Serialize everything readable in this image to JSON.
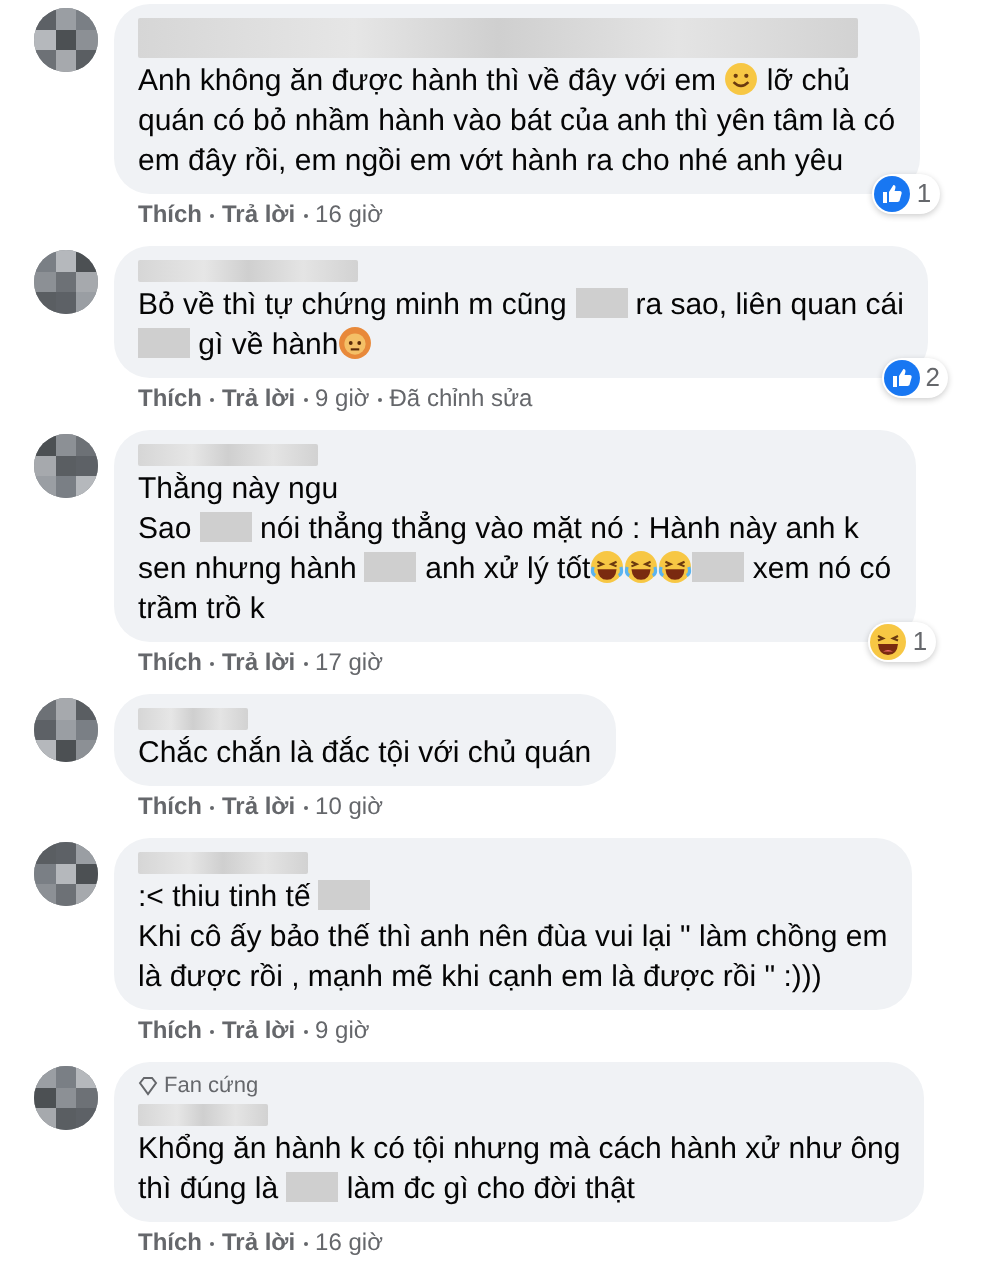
{
  "comments": [
    {
      "author_blurred": true,
      "lines": [
        [
          {
            "kind": "text",
            "text": "Anh không ăn được hành thì về đây với em "
          },
          {
            "kind": "smile"
          },
          {
            "kind": "text",
            "text": " lỡ chủ"
          }
        ],
        [
          {
            "kind": "text",
            "text": "quán có bỏ nhầm hành vào bát của anh thì yên tâm là có"
          }
        ],
        [
          {
            "kind": "text",
            "text": "em đây rồi, em ngồi em vớt hành ra cho nhé anh yêu"
          }
        ]
      ],
      "reaction": {
        "kind": "like",
        "count": "1"
      },
      "actions": [
        "Thích",
        "Trả lời",
        "16 giờ"
      ]
    },
    {
      "author_blurred": true,
      "lines": [
        [
          {
            "kind": "text",
            "text": "Bỏ về thì tự chứng minh m cũng "
          },
          {
            "kind": "censor"
          },
          {
            "kind": "text",
            "text": " ra sao, liên quan cái"
          }
        ],
        [
          {
            "kind": "censor"
          },
          {
            "kind": "text",
            "text": " gì về hành"
          },
          {
            "kind": "angry"
          }
        ]
      ],
      "reaction": {
        "kind": "like",
        "count": "2"
      },
      "actions": [
        "Thích",
        "Trả lời",
        "9 giờ",
        "Đã chỉnh sửa"
      ]
    },
    {
      "author_blurred": true,
      "lines": [
        [
          {
            "kind": "text",
            "text": "Thằng này ngu"
          }
        ],
        [
          {
            "kind": "text",
            "text": "Sao "
          },
          {
            "kind": "censor"
          },
          {
            "kind": "text",
            "text": " nói thẳng thẳng vào mặt nó : Hành này anh k"
          }
        ],
        [
          {
            "kind": "text",
            "text": "sen nhưng hành "
          },
          {
            "kind": "censor"
          },
          {
            "kind": "text",
            "text": " anh xử lý tốt"
          },
          {
            "kind": "laugh"
          },
          {
            "kind": "laugh"
          },
          {
            "kind": "laugh"
          },
          {
            "kind": "censor"
          },
          {
            "kind": "text",
            "text": " xem nó có"
          }
        ],
        [
          {
            "kind": "text",
            "text": "trầm trồ k"
          }
        ]
      ],
      "reaction": {
        "kind": "haha",
        "count": "1"
      },
      "actions": [
        "Thích",
        "Trả lời",
        "17 giờ"
      ]
    },
    {
      "author_blurred": true,
      "lines": [
        [
          {
            "kind": "text",
            "text": "Chắc chắn là đắc tội với chủ quán"
          }
        ]
      ],
      "actions": [
        "Thích",
        "Trả lời",
        "10 giờ"
      ]
    },
    {
      "author_blurred": true,
      "lines": [
        [
          {
            "kind": "text",
            "text": ":< thiu tinh tế "
          },
          {
            "kind": "censor"
          }
        ],
        [
          {
            "kind": "text",
            "text": "Khi cô ấy bảo thế thì anh nên đùa vui lại \" làm chồng em"
          }
        ],
        [
          {
            "kind": "text",
            "text": "là được rồi , mạnh mẽ khi cạnh em là được rồi \" :)))"
          }
        ]
      ],
      "actions": [
        "Thích",
        "Trả lời",
        "9 giờ"
      ]
    },
    {
      "author_blurred": true,
      "badge": "Fan cứng",
      "lines": [
        [
          {
            "kind": "text",
            "text": "Khổng ăn hành k có tội nhưng mà cách hành xử như ông"
          }
        ],
        [
          {
            "kind": "text",
            "text": "thì đúng là "
          },
          {
            "kind": "censor"
          },
          {
            "kind": "text",
            "text": " làm đc gì cho đời thật"
          }
        ]
      ],
      "actions": [
        "Thích",
        "Trả lời",
        "16 giờ"
      ]
    }
  ]
}
